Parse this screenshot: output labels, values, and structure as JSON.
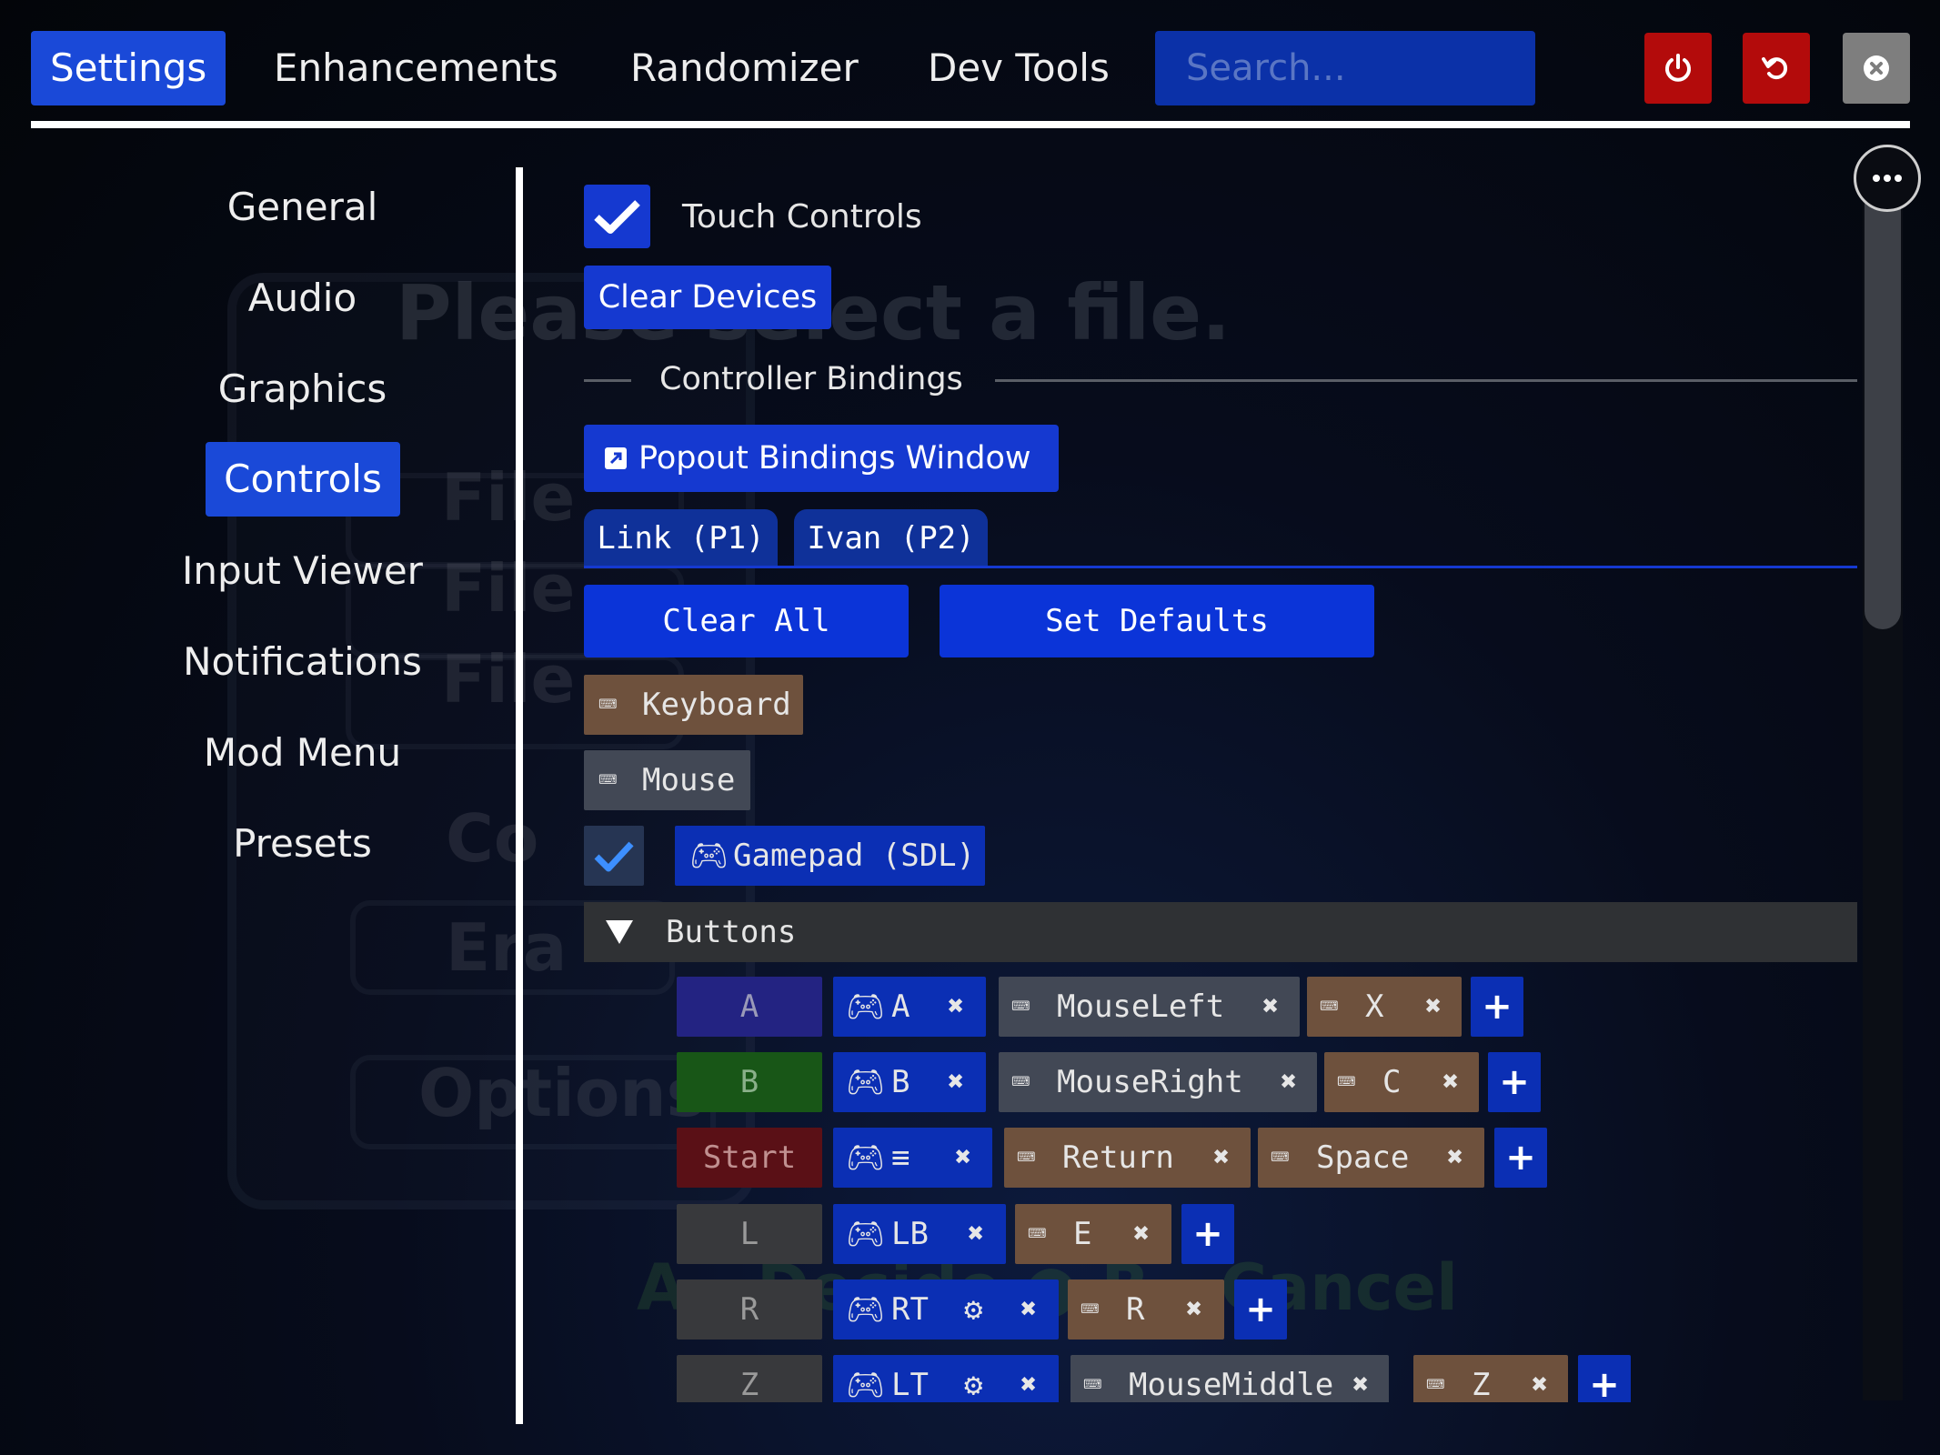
{
  "top_tabs": [
    "Settings",
    "Enhancements",
    "Randomizer",
    "Dev Tools"
  ],
  "search": {
    "placeholder": "Search..."
  },
  "top_icons": {
    "power": "power-icon",
    "reset": "reset-icon",
    "close": "close-icon"
  },
  "sidebar": [
    "General",
    "Audio",
    "Graphics",
    "Controls",
    "Input Viewer",
    "Notifications",
    "Mod Menu",
    "Presets"
  ],
  "background_text": {
    "title": "Please select a file.",
    "items": [
      "File",
      "File",
      "File",
      "Co",
      "Era",
      "Options"
    ],
    "hint": "A - Decide  ● B - Cancel"
  },
  "panel": {
    "touch_controls": {
      "label": "Touch Controls",
      "checked": true
    },
    "clear_devices": "Clear Devices",
    "section_title": "Controller Bindings",
    "popout": "Popout Bindings Window",
    "player_tabs": [
      "Link (P1)",
      "Ivan (P2)"
    ],
    "clear_all": "Clear All",
    "set_defaults": "Set Defaults",
    "devices": {
      "keyboard": "Keyboard",
      "mouse": "Mouse",
      "gamepad": "Gamepad (SDL)",
      "gamepad_checked": true
    },
    "buttons_header": "Buttons",
    "rows": [
      {
        "label": "A",
        "pad": "A",
        "keys": [
          "MouseLeft",
          "X"
        ]
      },
      {
        "label": "B",
        "pad": "B",
        "keys": [
          "MouseRight",
          "C"
        ]
      },
      {
        "label": "Start",
        "pad": "≡",
        "keys": [
          "Return",
          "Space"
        ]
      },
      {
        "label": "L",
        "pad": "LB",
        "keys": [
          "E"
        ]
      },
      {
        "label": "R",
        "pad": "RT",
        "keys": [
          "R"
        ]
      },
      {
        "label": "Z",
        "pad": "LT",
        "keys": [
          "MouseMiddle",
          "Z"
        ]
      }
    ]
  },
  "colors": {
    "accent": "#1a49d8",
    "button": "#1539d0",
    "pad_chip": "#0b2fb4",
    "keyboard_chip": "#6e513d",
    "mouse_chip": "#424855",
    "danger": "#b30b0b"
  }
}
